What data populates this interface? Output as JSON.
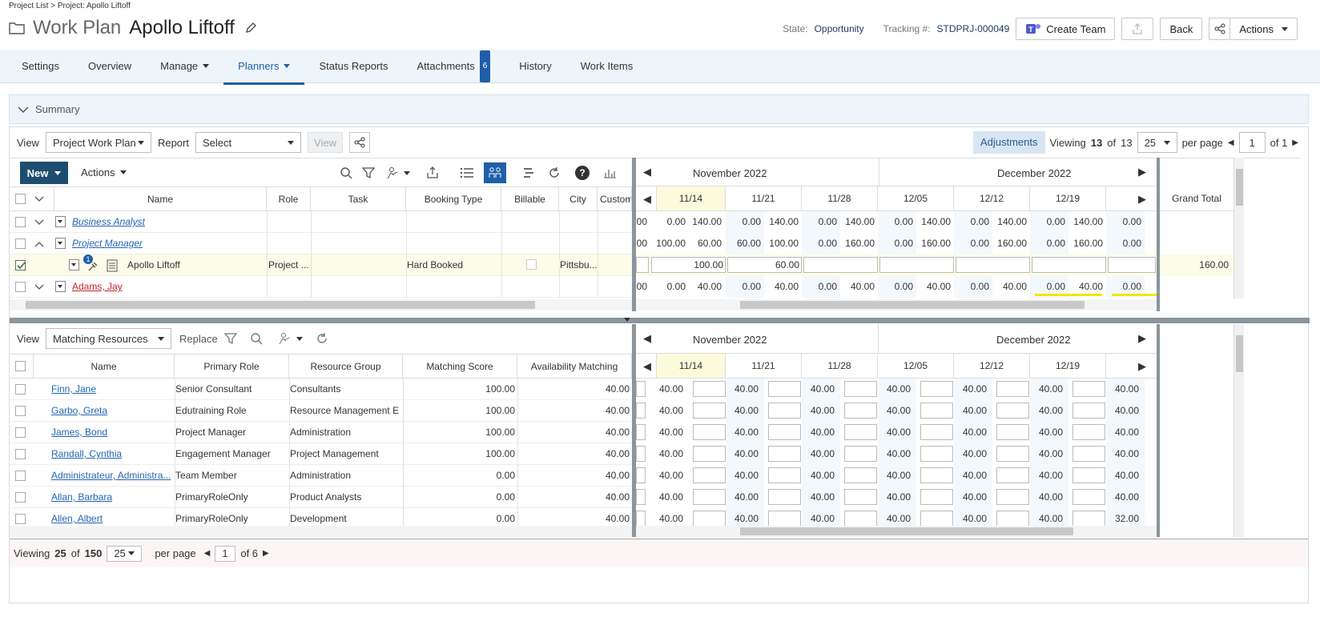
{
  "breadcrumb": {
    "project_list": "Project List",
    "sep": " > ",
    "project": "Project: Apollo Liftoff"
  },
  "header": {
    "title": "Work Plan",
    "project_name": "Apollo Liftoff",
    "state_label": "State:",
    "state_value": "Opportunity",
    "tracking_label": "Tracking #:",
    "tracking_value": "STDPRJ-000049",
    "create_team": "Create Team",
    "back": "Back",
    "actions": "Actions"
  },
  "tabs": [
    {
      "label": "Settings"
    },
    {
      "label": "Overview"
    },
    {
      "label": "Manage"
    },
    {
      "label": "Planners"
    },
    {
      "label": "Status Reports"
    },
    {
      "label": "Attachments",
      "badge": "6"
    },
    {
      "label": "History"
    },
    {
      "label": "Work Items"
    }
  ],
  "summary": {
    "label": "Summary"
  },
  "toolbar": {
    "view_label": "View",
    "view_value": "Project Work Plan",
    "report_label": "Report",
    "report_value": "Select",
    "view_btn": "View",
    "adjustments": "Adjustments",
    "viewing_pre": "Viewing",
    "viewing_count": "13",
    "viewing_mid": "of",
    "viewing_total": "13",
    "per_page_value": "25",
    "per_page_label": "per page",
    "page_value": "1",
    "page_of": "of 1"
  },
  "planner": {
    "new_label": "New",
    "actions_label": "Actions",
    "columns": [
      "Name",
      "Role",
      "Task",
      "Booking Type",
      "Billable",
      "City",
      "Custom"
    ],
    "months": [
      "November 2022",
      "December 2022"
    ],
    "weeks": [
      "11/14",
      "11/21",
      "11/28",
      "12/05",
      "12/12",
      "12/19"
    ],
    "grand_total": "Grand Total",
    "rows": [
      {
        "name": "Business Analyst",
        "role": "",
        "task": "",
        "booking": "",
        "billable": "",
        "city": "",
        "lead": "00",
        "vals": [
          "0.00",
          "140.00",
          "0.00",
          "140.00",
          "0.00",
          "140.00",
          "0.00",
          "140.00",
          "0.00",
          "140.00",
          "0.00",
          "140.00",
          "0.00"
        ],
        "total": ""
      },
      {
        "name": "Project Manager",
        "role": "",
        "task": "",
        "booking": "",
        "billable": "",
        "city": "",
        "lead": "00",
        "vals": [
          "100.00",
          "60.00",
          "60.00",
          "100.00",
          "0.00",
          "160.00",
          "0.00",
          "160.00",
          "0.00",
          "160.00",
          "0.00",
          "160.00",
          "0.00"
        ],
        "total": ""
      },
      {
        "name": "Apollo Liftoff",
        "role": "Project ...",
        "task": "",
        "booking": "Hard Booked",
        "billable": "",
        "city": "Pittsbu...",
        "lead": "",
        "vals": [
          "100.00",
          "60.00",
          "",
          "",
          "",
          "",
          ""
        ],
        "total": "160.00",
        "badge": "1"
      },
      {
        "name": "Adams, Jay",
        "role": "",
        "task": "",
        "booking": "",
        "billable": "",
        "city": "",
        "lead": "00",
        "vals": [
          "0.00",
          "40.00",
          "0.00",
          "40.00",
          "0.00",
          "40.00",
          "0.00",
          "40.00",
          "0.00",
          "40.00",
          "0.00",
          "40.00",
          "0.00"
        ],
        "total": ""
      }
    ]
  },
  "resources": {
    "view_label": "View",
    "view_value": "Matching Resources",
    "replace_label": "Replace",
    "columns": [
      "Name",
      "Primary Role",
      "Resource Group",
      "Matching Score",
      "Availability Matching"
    ],
    "months": [
      "November 2022",
      "December 2022"
    ],
    "weeks": [
      "11/14",
      "11/21",
      "11/28",
      "12/05",
      "12/12",
      "12/19"
    ],
    "rows": [
      {
        "name": "Finn, Jane",
        "role": "Senior Consultant",
        "group": "Consultants",
        "score": "100.00",
        "avail": "40.00",
        "vals": [
          "40.00",
          "40.00",
          "40.00",
          "40.00",
          "40.00",
          "40.00",
          "40.00"
        ]
      },
      {
        "name": "Garbo, Greta",
        "role": "Edutraining Role",
        "group": "Resource Management E",
        "score": "100.00",
        "avail": "40.00",
        "vals": [
          "40.00",
          "40.00",
          "40.00",
          "40.00",
          "40.00",
          "40.00",
          "40.00"
        ]
      },
      {
        "name": "James, Bond",
        "role": "Project Manager",
        "group": "Administration",
        "score": "100.00",
        "avail": "40.00",
        "vals": [
          "40.00",
          "40.00",
          "40.00",
          "40.00",
          "40.00",
          "40.00",
          "40.00"
        ]
      },
      {
        "name": "Randall, Cynthia",
        "role": "Engagement Manager",
        "group": "Project Management",
        "score": "100.00",
        "avail": "40.00",
        "vals": [
          "40.00",
          "40.00",
          "40.00",
          "40.00",
          "40.00",
          "40.00",
          "40.00"
        ]
      },
      {
        "name": "Administrateur, Administra...",
        "role": "Team Member",
        "group": "Administration",
        "score": "0.00",
        "avail": "40.00",
        "vals": [
          "40.00",
          "40.00",
          "40.00",
          "40.00",
          "40.00",
          "40.00",
          "40.00"
        ]
      },
      {
        "name": "Allan, Barbara",
        "role": "PrimaryRoleOnly",
        "group": "Product Analysts",
        "score": "0.00",
        "avail": "40.00",
        "vals": [
          "40.00",
          "40.00",
          "40.00",
          "40.00",
          "40.00",
          "40.00",
          "40.00"
        ]
      },
      {
        "name": "Allen, Albert",
        "role": "PrimaryRoleOnly",
        "group": "Development",
        "score": "0.00",
        "avail": "40.00",
        "vals": [
          "40.00",
          "40.00",
          "40.00",
          "40.00",
          "40.00",
          "40.00",
          "32.00"
        ]
      }
    ]
  },
  "footer": {
    "viewing_pre": "Viewing",
    "viewing_count": "25",
    "viewing_mid": "of",
    "viewing_total": "150",
    "per_page_value": "25",
    "per_page_label": "per page",
    "page_value": "1",
    "page_of": "of 6"
  }
}
